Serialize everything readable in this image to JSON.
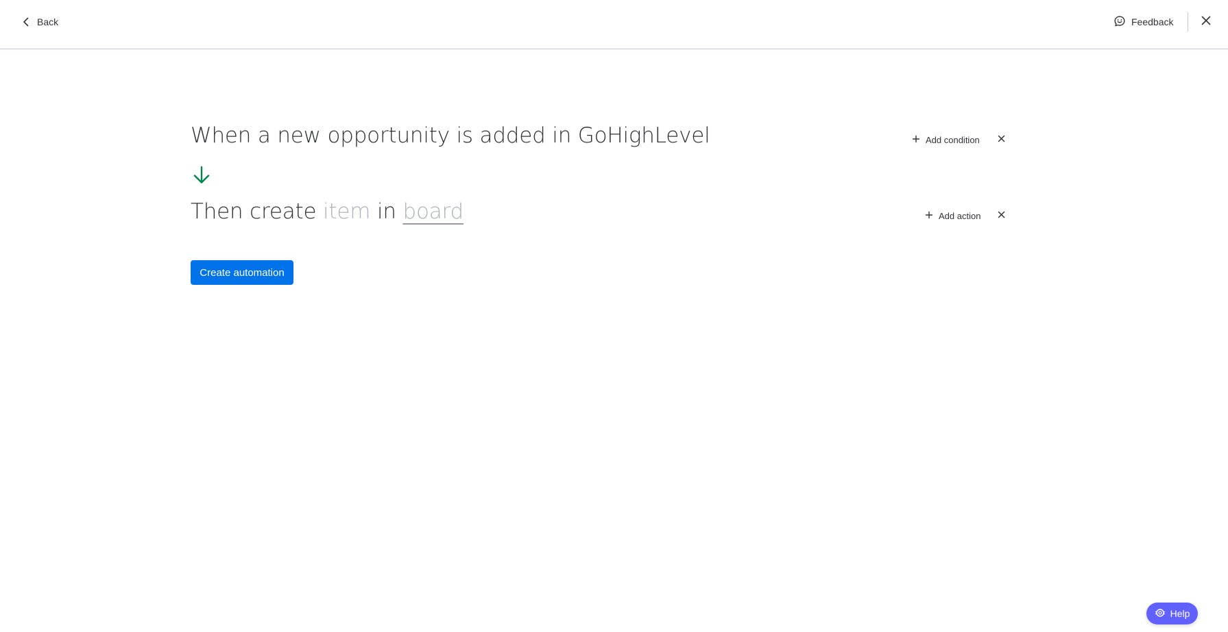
{
  "header": {
    "back_label": "Back",
    "feedback_label": "Feedback"
  },
  "recipe": {
    "trigger_text": "When a new opportunity is added in GoHighLevel",
    "action_prefix": "Then create",
    "action_item_placeholder": "item",
    "action_connector": "in",
    "action_board_placeholder": "board",
    "add_condition_label": "Add condition",
    "add_action_label": "Add action"
  },
  "footer": {
    "create_button_label": "Create automation",
    "help_label": "Help"
  },
  "colors": {
    "primary": "#0073ea",
    "help": "#6161ff",
    "arrow": "#00854d",
    "placeholder": "#b0b2bc"
  },
  "icons": {
    "back": "chevron-left-icon",
    "feedback": "feedback-icon",
    "close": "close-icon",
    "arrow": "arrow-down-icon",
    "add": "plus-icon",
    "remove": "close-icon",
    "help": "help-icon"
  }
}
